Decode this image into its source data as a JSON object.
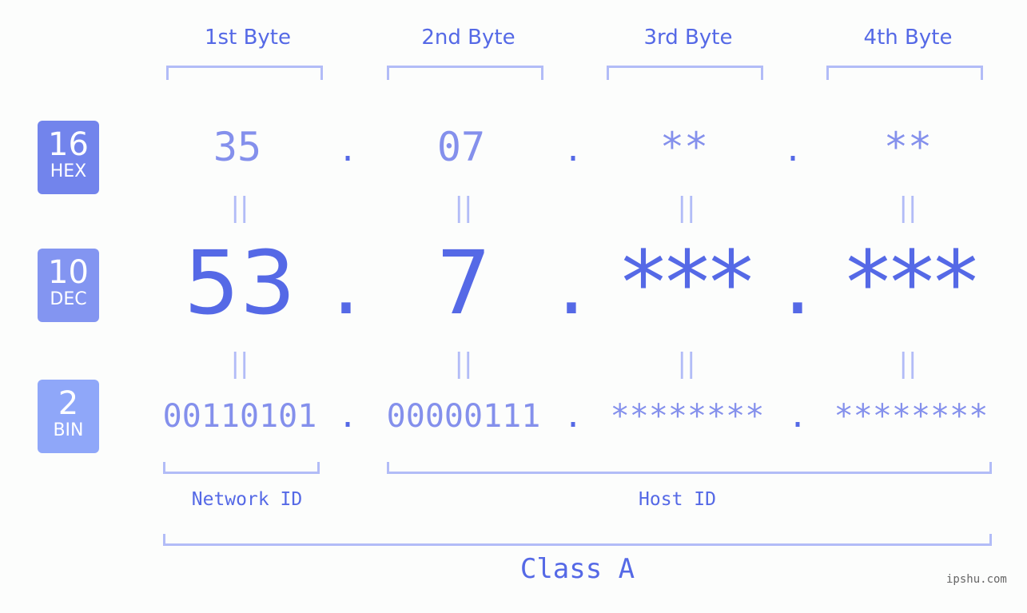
{
  "bytes": [
    {
      "label": "1st Byte",
      "hex": "35",
      "dec": "53",
      "bin": "00110101"
    },
    {
      "label": "2nd Byte",
      "hex": "07",
      "dec": "7",
      "bin": "00000111"
    },
    {
      "label": "3rd Byte",
      "hex": "**",
      "dec": "***",
      "bin": "********"
    },
    {
      "label": "4th Byte",
      "hex": "**",
      "dec": "***",
      "bin": "********"
    }
  ],
  "separator": ".",
  "equals": "||",
  "badges": {
    "hex": {
      "num": "16",
      "label": "HEX",
      "color": "#7284ec"
    },
    "dec": {
      "num": "10",
      "label": "DEC",
      "color": "#8395f1"
    },
    "bin": {
      "num": "2",
      "label": "BIN",
      "color": "#8fa7f9"
    }
  },
  "network_id_label": "Network ID",
  "host_id_label": "Host ID",
  "class_label": "Class A",
  "footer": "ipshu.com"
}
